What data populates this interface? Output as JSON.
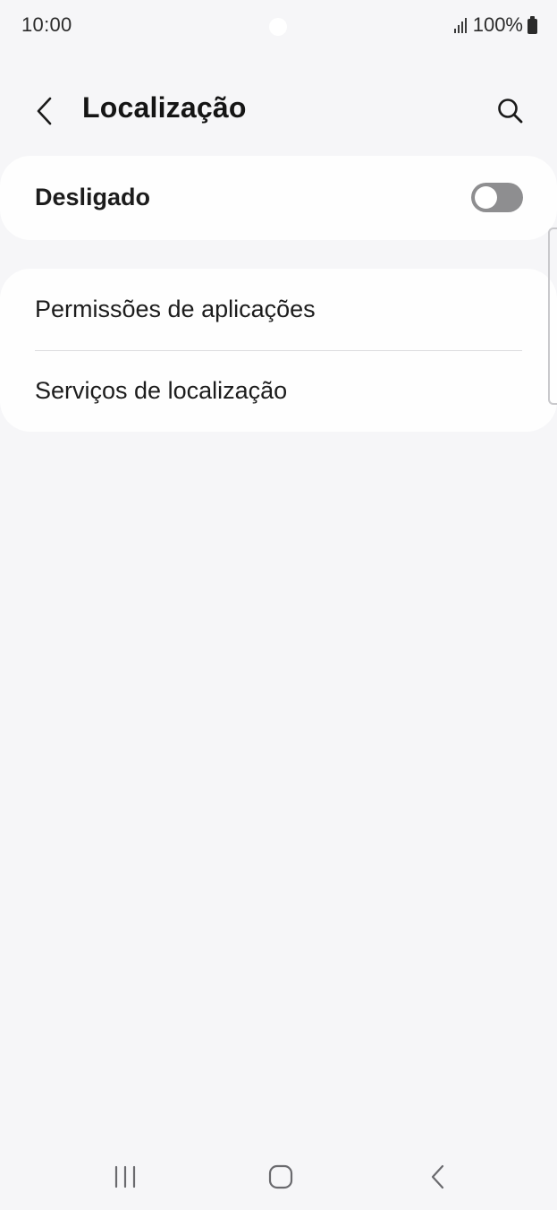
{
  "status_bar": {
    "time": "10:00",
    "battery": "100%",
    "signal_icon": "signal-bars-icon",
    "battery_icon": "battery-icon"
  },
  "app_bar": {
    "title": "Localização",
    "back_icon": "chevron-left-icon",
    "search_icon": "search-icon"
  },
  "location_toggle": {
    "label": "Desligado",
    "state": "off"
  },
  "menu": {
    "items": [
      {
        "label": "Permissões de aplicações"
      },
      {
        "label": "Serviços de localização"
      }
    ]
  },
  "nav_bar": {
    "recents_icon": "recents-icon",
    "home_icon": "home-icon",
    "back_icon": "back-icon"
  },
  "colors": {
    "background": "#f6f6f8",
    "card": "#fefefe",
    "toggle_off": "#8e8e90",
    "text": "#1c1c1c"
  }
}
